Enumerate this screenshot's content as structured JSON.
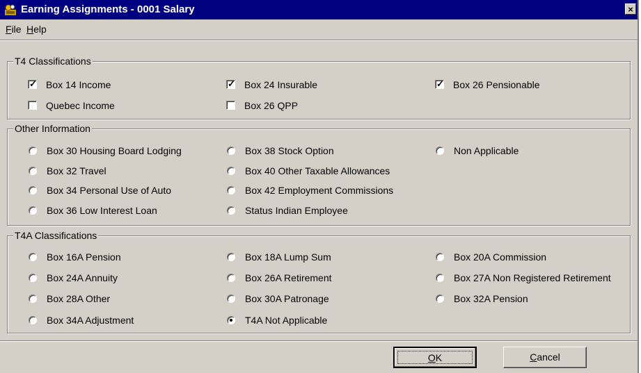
{
  "window": {
    "title": "Earning Assignments - 0001 Salary",
    "close_label": "×"
  },
  "menu": [
    {
      "label": "File",
      "accel": "F",
      "rest": "ile"
    },
    {
      "label": "Help",
      "accel": "H",
      "rest": "elp"
    }
  ],
  "t4": {
    "label": "T4 Classifications",
    "items": [
      {
        "label": "Box 14 Income",
        "checked": true
      },
      {
        "label": "Box 24 Insurable",
        "checked": true
      },
      {
        "label": "Box 26 Pensionable",
        "checked": true
      },
      {
        "label": "Quebec Income",
        "checked": false
      },
      {
        "label": "Box 26 QPP",
        "checked": false
      }
    ]
  },
  "other": {
    "label": "Other Information",
    "items": [
      {
        "label": "Box 30 Housing Board Lodging",
        "selected": false
      },
      {
        "label": "Box 38 Stock Option",
        "selected": false
      },
      {
        "label": "Non Applicable",
        "selected": false
      },
      {
        "label": "Box 32 Travel",
        "selected": false
      },
      {
        "label": "Box 40 Other Taxable Allowances",
        "selected": false
      },
      {
        "label": "Box 34 Personal Use of Auto",
        "selected": false
      },
      {
        "label": "Box 42 Employment Commissions",
        "selected": false
      },
      {
        "label": "Box 36 Low Interest Loan",
        "selected": false
      },
      {
        "label": "Status Indian Employee",
        "selected": false
      }
    ]
  },
  "t4a": {
    "label": "T4A Classifications",
    "items": [
      {
        "label": "Box 16A Pension",
        "selected": false
      },
      {
        "label": "Box 18A Lump Sum",
        "selected": false
      },
      {
        "label": "Box 20A Commission",
        "selected": false
      },
      {
        "label": "Box 24A Annuity",
        "selected": false
      },
      {
        "label": "Box 26A Retirement",
        "selected": false
      },
      {
        "label": "Box 27A Non Registered Retirement",
        "selected": false
      },
      {
        "label": "Box 28A Other",
        "selected": false
      },
      {
        "label": "Box 30A Patronage",
        "selected": false
      },
      {
        "label": "Box 32A Pension",
        "selected": false
      },
      {
        "label": "Box 34A Adjustment",
        "selected": false
      },
      {
        "label": "T4A Not Applicable",
        "selected": true
      }
    ]
  },
  "buttons": {
    "ok": {
      "label": "OK",
      "accel": "O",
      "rest": "K"
    },
    "cancel": {
      "label": "Cancel",
      "accel": "C",
      "rest": "ancel"
    }
  }
}
